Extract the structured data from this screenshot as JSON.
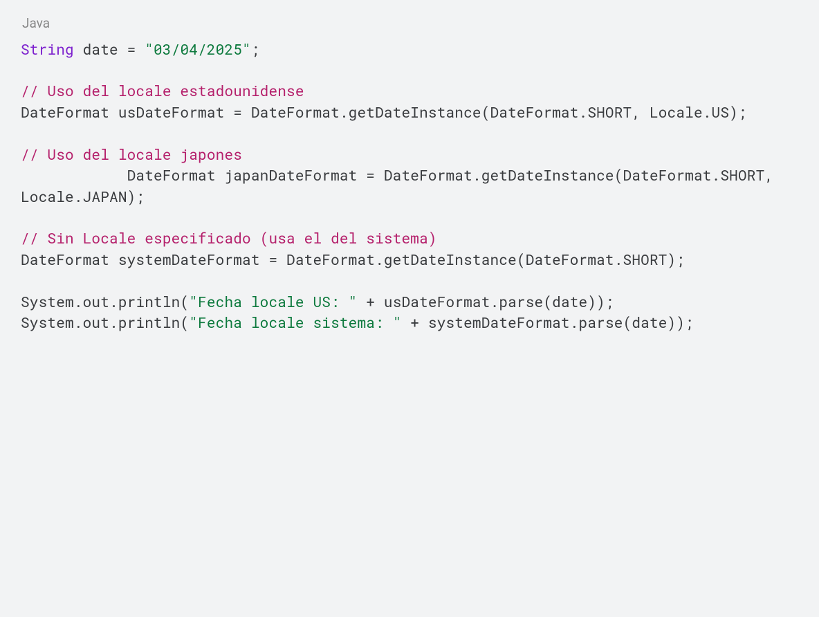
{
  "language_label": "Java",
  "code": {
    "l1_kw": "String",
    "l1_mid": " date = ",
    "l1_str": "\"03/04/2025\"",
    "l1_end": ";",
    "blank1": "",
    "c1": "// Uso del locale estadounidense",
    "l2": "DateFormat usDateFormat = DateFormat.getDateInstance(DateFormat.SHORT, Locale.US);",
    "blank2": "",
    "c2": "// Uso del locale japones",
    "l3a": "            DateFormat japanDateFormat = DateFormat.getDateInstance(DateFormat.SHORT, Locale.JAPAN);",
    "blank3": "",
    "c3": "// Sin Locale especificado (usa el del sistema)",
    "l4": "DateFormat systemDateFormat = DateFormat.getDateInstance(DateFormat.SHORT);",
    "blank4": "",
    "l5_pre": "System.out.println(",
    "l5_str": "\"Fecha locale US: \"",
    "l5_post": " + usDateFormat.parse(date));",
    "l6_pre": "System.out.println(",
    "l6_str": "\"Fecha locale sistema: \"",
    "l6_post": " + systemDateFormat.parse(date));"
  }
}
